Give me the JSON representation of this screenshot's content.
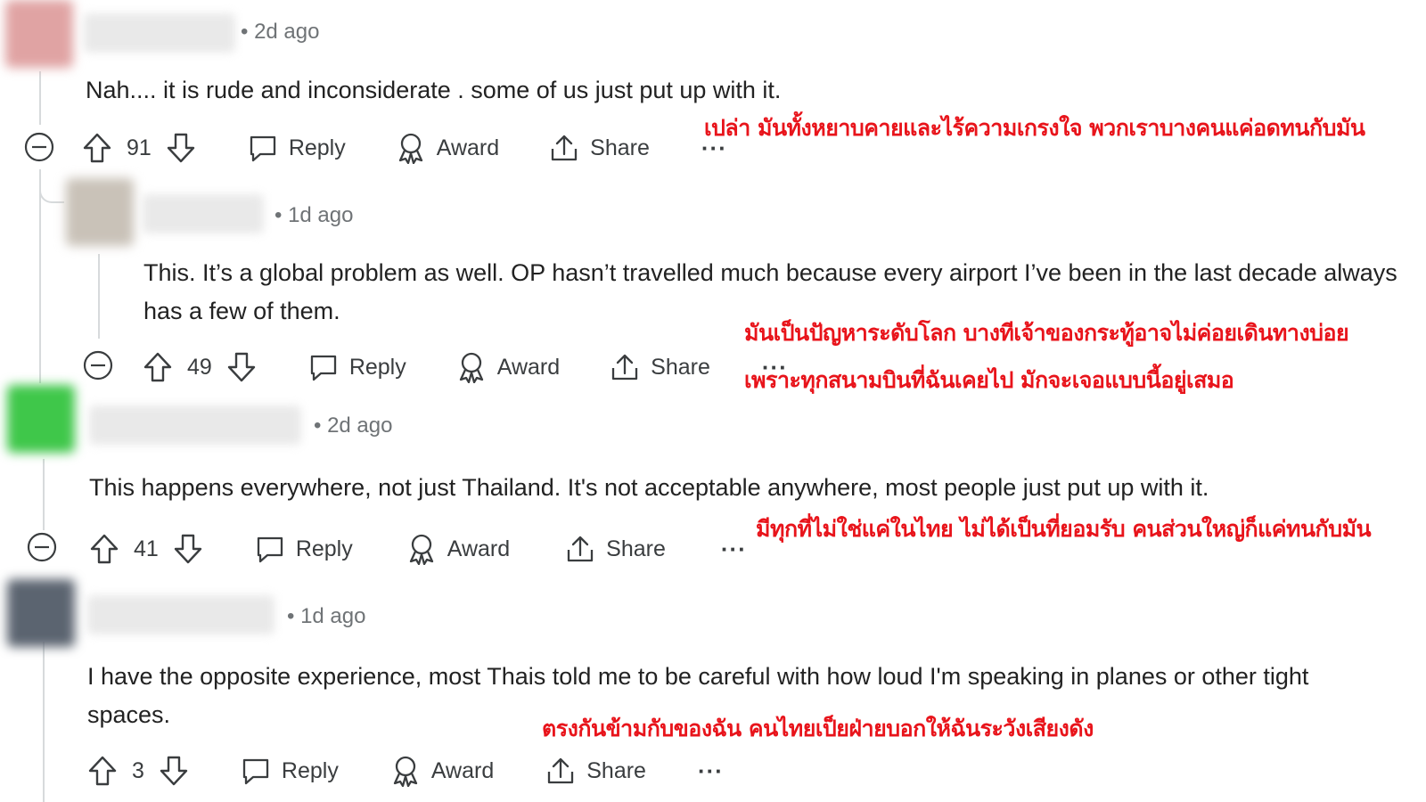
{
  "comments": [
    {
      "time": "• 2d ago",
      "text": "Nah.... it is rude and inconsiderate . some of us just put up with it.",
      "votes": "91",
      "reply": "Reply",
      "award": "Award",
      "share": "Share",
      "more": "···",
      "translation": "เปล่า มันทั้งหยาบคายและไร้ความเกรงใจ พวกเราบางคนแค่อดทนกับมัน",
      "avatar_color": "#e0a3a3"
    },
    {
      "time": "• 1d ago",
      "text": "This. It’s a global problem as well. OP hasn’t travelled much because every airport I’ve been in the last decade always has a few of them.",
      "votes": "49",
      "reply": "Reply",
      "award": "Award",
      "share": "Share",
      "more": "···",
      "translation_1": "มันเป็นปัญหาระดับโลก บางทีเจ้าของกระทู้อาจไม่ค่อยเดินทางบ่อย",
      "translation_2": "เพราะทุกสนามบินที่ฉันเคยไป มักจะเจอแบบนี้อยู่เสมอ",
      "avatar_color": "#c9c2b8"
    },
    {
      "time": "• 2d ago",
      "text": "This happens everywhere, not just Thailand. It's not acceptable anywhere, most people just put up with it.",
      "votes": "41",
      "reply": "Reply",
      "award": "Award",
      "share": "Share",
      "more": "···",
      "translation": "มีทุกที่ไม่ใช่แค่ในไทย ไม่ได้เป็นที่ยอมรับ คนส่วนใหญ่ก็แค่ทนกับมัน",
      "avatar_color": "#3fc74a"
    },
    {
      "time": "• 1d ago",
      "text": "I have the opposite experience, most Thais told me to be careful with how loud I'm speaking in planes or other tight spaces.",
      "votes": "3",
      "reply": "Reply",
      "award": "Award",
      "share": "Share",
      "more": "···",
      "translation": "ตรงกันข้ามกับของฉัน คนไทยเป็ยฝ่ายบอกให้ฉันระวังเสียงดัง",
      "avatar_color": "#5b6470"
    }
  ]
}
